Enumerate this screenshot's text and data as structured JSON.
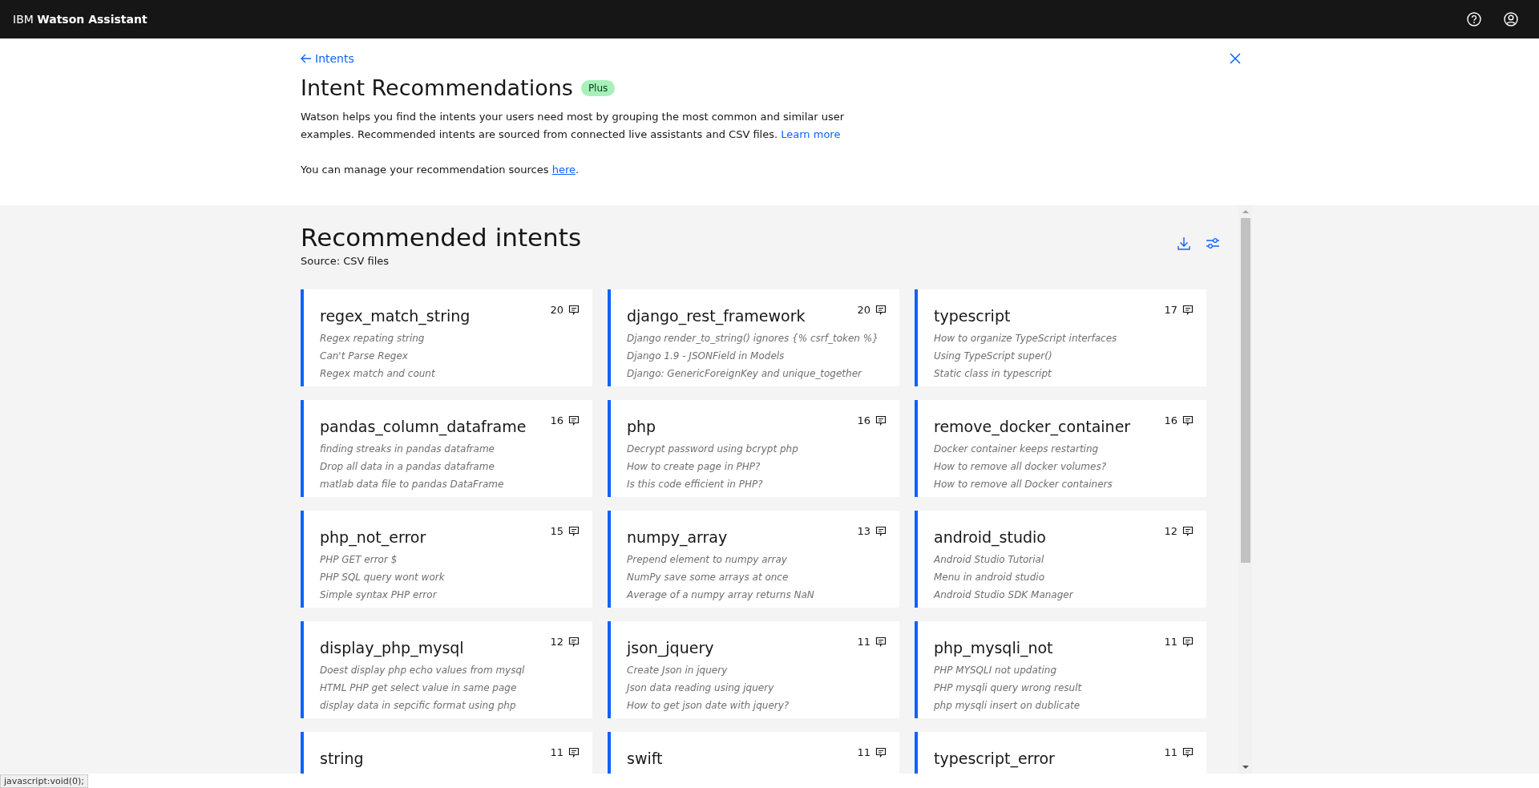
{
  "header": {
    "product": "IBM **Watson Assistant**"
  },
  "back_link": "Intents",
  "title": "Intent Recommendations",
  "badge": "Plus",
  "description": "Watson helps you find the intents your users need most by grouping the most common and similar user examples. Recommended intents are sourced from connected live assistants and CSV files.",
  "learn_more": "Learn more",
  "manage_text": "You can manage your recommendation sources",
  "manage_link": "here",
  "manage_end": ".",
  "section": {
    "title": "Recommended intents",
    "source": "Source: CSV files"
  },
  "cards": [
    {
      "name": "regex_match_string",
      "count": "20",
      "examples": [
        "Regex repating string",
        "Can't Parse Regex",
        "Regex match and count"
      ]
    },
    {
      "name": "django_rest_framework",
      "count": "20",
      "examples": [
        "Django render_to_string() ignores {% csrf_token %}",
        "Django 1.9 - JSONField in Models",
        "Django: GenericForeignKey and unique_together"
      ]
    },
    {
      "name": "typescript",
      "count": "17",
      "examples": [
        "How to organize TypeScript interfaces",
        "Using TypeScript super()",
        "Static class in typescript"
      ]
    },
    {
      "name": "pandas_column_dataframe",
      "count": "16",
      "examples": [
        "finding streaks in pandas dataframe",
        "Drop all data in a pandas dataframe",
        "matlab data file to pandas DataFrame"
      ]
    },
    {
      "name": "php",
      "count": "16",
      "examples": [
        "Decrypt password using bcrypt php",
        "How to create page in PHP?",
        "Is this code efficient in PHP?"
      ]
    },
    {
      "name": "remove_docker_container",
      "count": "16",
      "examples": [
        "Docker container keeps restarting",
        "How to remove all docker volumes?",
        "How to remove all Docker containers"
      ]
    },
    {
      "name": "php_not_error",
      "count": "15",
      "examples": [
        "PHP GET error $",
        "PHP SQL query wont work",
        "Simple syntax PHP error"
      ]
    },
    {
      "name": "numpy_array",
      "count": "13",
      "examples": [
        "Prepend element to numpy array",
        "NumPy save some arrays at once",
        "Average of a numpy array returns NaN"
      ]
    },
    {
      "name": "android_studio",
      "count": "12",
      "examples": [
        "Android Studio Tutorial",
        "Menu in android studio",
        "Android Studio SDK Manager"
      ]
    },
    {
      "name": "display_php_mysql",
      "count": "12",
      "examples": [
        "Doest display php echo values from mysql",
        "HTML PHP get select value in same page",
        "display data in sepcific format using php"
      ]
    },
    {
      "name": "json_jquery",
      "count": "11",
      "examples": [
        "Create Json in jquery",
        "Json data reading using jquery",
        "How to get json date with jquery?"
      ]
    },
    {
      "name": "php_mysqli_not",
      "count": "11",
      "examples": [
        "PHP MYSQLI not updating",
        "PHP mysqli query wrong result",
        "php mysqli insert on dublicate"
      ]
    },
    {
      "name": "string",
      "count": "11"
    },
    {
      "name": "swift",
      "count": "11"
    },
    {
      "name": "typescript_error",
      "count": "11"
    }
  ],
  "status_bar": "javascript:void(0);"
}
